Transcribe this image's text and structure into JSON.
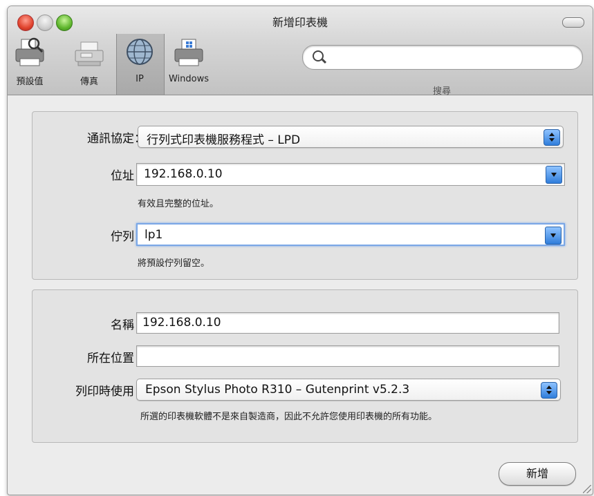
{
  "window": {
    "title": "新增印表機"
  },
  "toolbar": {
    "items": [
      {
        "label": "預設值",
        "icon": "default-printer-icon"
      },
      {
        "label": "傳真",
        "icon": "fax-icon"
      },
      {
        "label": "IP",
        "icon": "ip-globe-icon",
        "selected": true
      },
      {
        "label": "Windows",
        "icon": "windows-printer-icon"
      }
    ],
    "search": {
      "label": "搜尋",
      "value": ""
    }
  },
  "connection": {
    "protocol_label": "通訊協定：",
    "protocol_value": "行列式印表機服務程式 – LPD",
    "address_label": "位址：",
    "address_value": "192.168.0.10",
    "address_hint": "有效且完整的位址。",
    "queue_label": "佇列：",
    "queue_value": "lp1",
    "queue_hint": "將預設佇列留空。"
  },
  "printer_info": {
    "name_label": "名稱：",
    "name_value": "192.168.0.10",
    "location_label": "所在位置：",
    "location_value": "",
    "driver_label": "列印時使用：",
    "driver_value": "Epson Stylus Photo R310 – Gutenprint v5.2.3",
    "driver_warning": "所選的印表機軟體不是來自製造商，因此不允許您使用印表機的所有功能。"
  },
  "actions": {
    "add_label": "新增"
  },
  "colors": {
    "accent": "#2f7ddb",
    "focus_ring": "#7aa7e6"
  }
}
